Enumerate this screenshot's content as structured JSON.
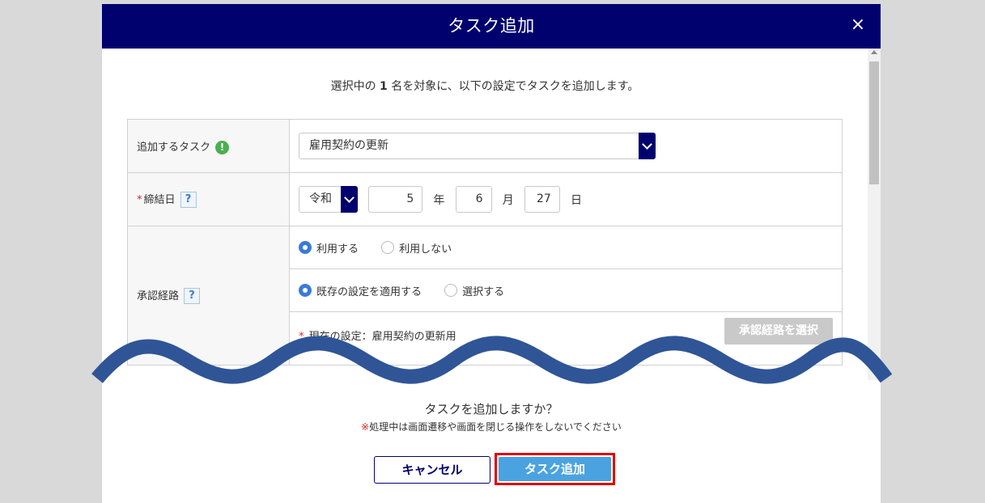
{
  "modal": {
    "title": "タスク追加",
    "close_label": "×"
  },
  "intro": {
    "prefix": "選択中の ",
    "count": "1",
    "suffix": " 名を対象に、以下の設定でタスクを追加します。"
  },
  "form": {
    "task": {
      "label": "追加するタスク",
      "info_icon": "!",
      "selected": "雇用契約の更新"
    },
    "date": {
      "required_mark": "*",
      "label": "締結日",
      "help": "?",
      "era": "令和",
      "year": "5",
      "year_unit": "年",
      "month": "6",
      "month_unit": "月",
      "day": "27",
      "day_unit": "日"
    },
    "approval": {
      "label": "承認経路",
      "help": "?",
      "use_option": "利用する",
      "nouse_option": "利用しない",
      "use_selected": true,
      "apply_option": "既存の設定を適用する",
      "choose_option": "選択する",
      "apply_selected": true,
      "current_required": "*",
      "current_setting": "現在の設定：雇用契約の更新用",
      "select_button": "承認経路を選択"
    }
  },
  "footer": {
    "question": "タスクを追加しますか？",
    "note_mark": "※",
    "note": "処理中は画面遷移や画面を閉じる操作をしないでください",
    "cancel_label": "キャンセル",
    "add_label": "タスク追加"
  },
  "colors": {
    "header_bg": "#00006e",
    "primary_btn": "#4aa3e0",
    "highlight": "#e00000",
    "wave": "#2f5597"
  },
  "icons": [
    "close-icon",
    "info-icon",
    "help-icon",
    "chevron-down-icon",
    "radio-icon"
  ]
}
